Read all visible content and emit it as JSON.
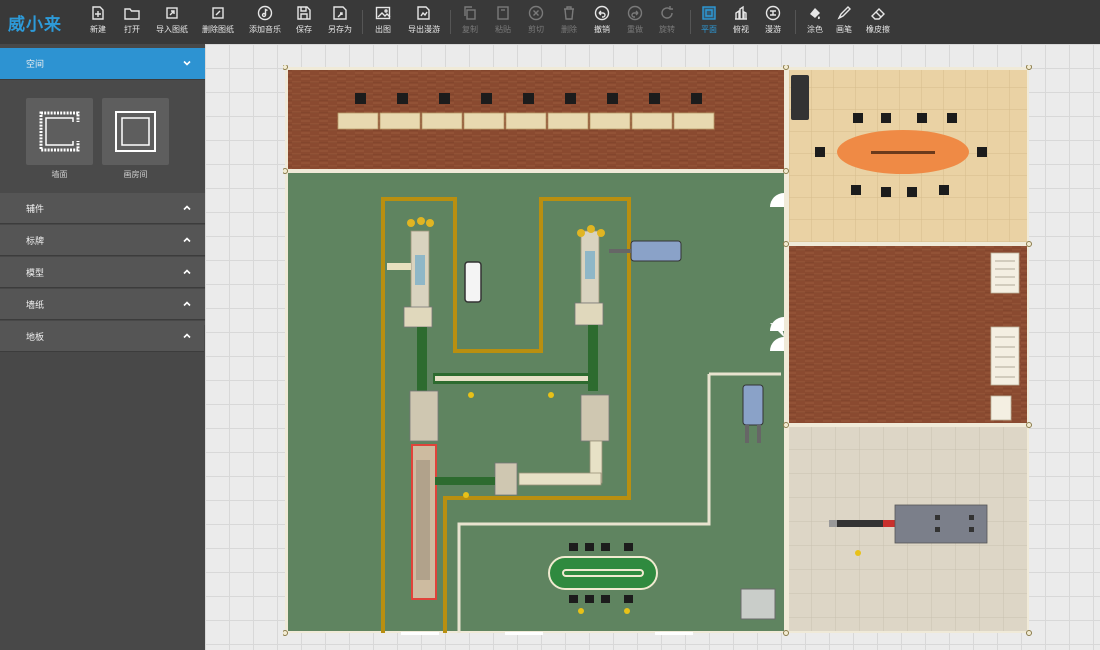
{
  "app": {
    "logo": "威小来"
  },
  "toolbar": {
    "new": "新建",
    "open": "打开",
    "import_drawing": "导入图纸",
    "delete_drawing": "删除图纸",
    "add_music": "添加音乐",
    "save": "保存",
    "save_as": "另存为",
    "export_image": "出图",
    "export_tour": "导出漫游",
    "copy": "复制",
    "paste": "粘贴",
    "cut": "剪切",
    "delete": "删除",
    "undo": "撤销",
    "redo": "重做",
    "rotate": "旋转",
    "plan_view": "平面",
    "top_view": "俯视",
    "roam": "漫游",
    "paint": "涂色",
    "brush": "画笔",
    "eraser": "橡皮擦"
  },
  "sidebar": {
    "space": {
      "title": "空间",
      "wall_label": "墙面",
      "room_label": "画房间"
    },
    "sections": [
      "辅件",
      "标牌",
      "模型",
      "墙纸",
      "地板"
    ]
  },
  "colors": {
    "toolbar_bg": "#393939",
    "accent": "#2d93d2",
    "factory_floor": "#5f8460",
    "wood_floor": "#8a4a30",
    "tile_floor": "#ead2a4",
    "path_yellow": "#b98f10"
  },
  "icons": {
    "new": "new-file-icon",
    "open": "folder-icon",
    "import": "import-icon",
    "delete_drawing": "delete-drawing-icon",
    "music": "music-icon",
    "save": "save-icon",
    "save_as": "save-as-icon",
    "image": "image-icon",
    "tour": "export-tour-icon",
    "copy": "copy-icon",
    "paste": "paste-icon",
    "cut": "cut-icon",
    "trash": "trash-icon",
    "undo": "undo-icon",
    "redo": "redo-icon",
    "rotate": "rotate-icon",
    "plan": "plan-view-icon",
    "top": "top-view-icon",
    "roam": "roam-icon",
    "paint": "paint-bucket-icon",
    "brush": "brush-icon",
    "eraser": "eraser-icon"
  }
}
